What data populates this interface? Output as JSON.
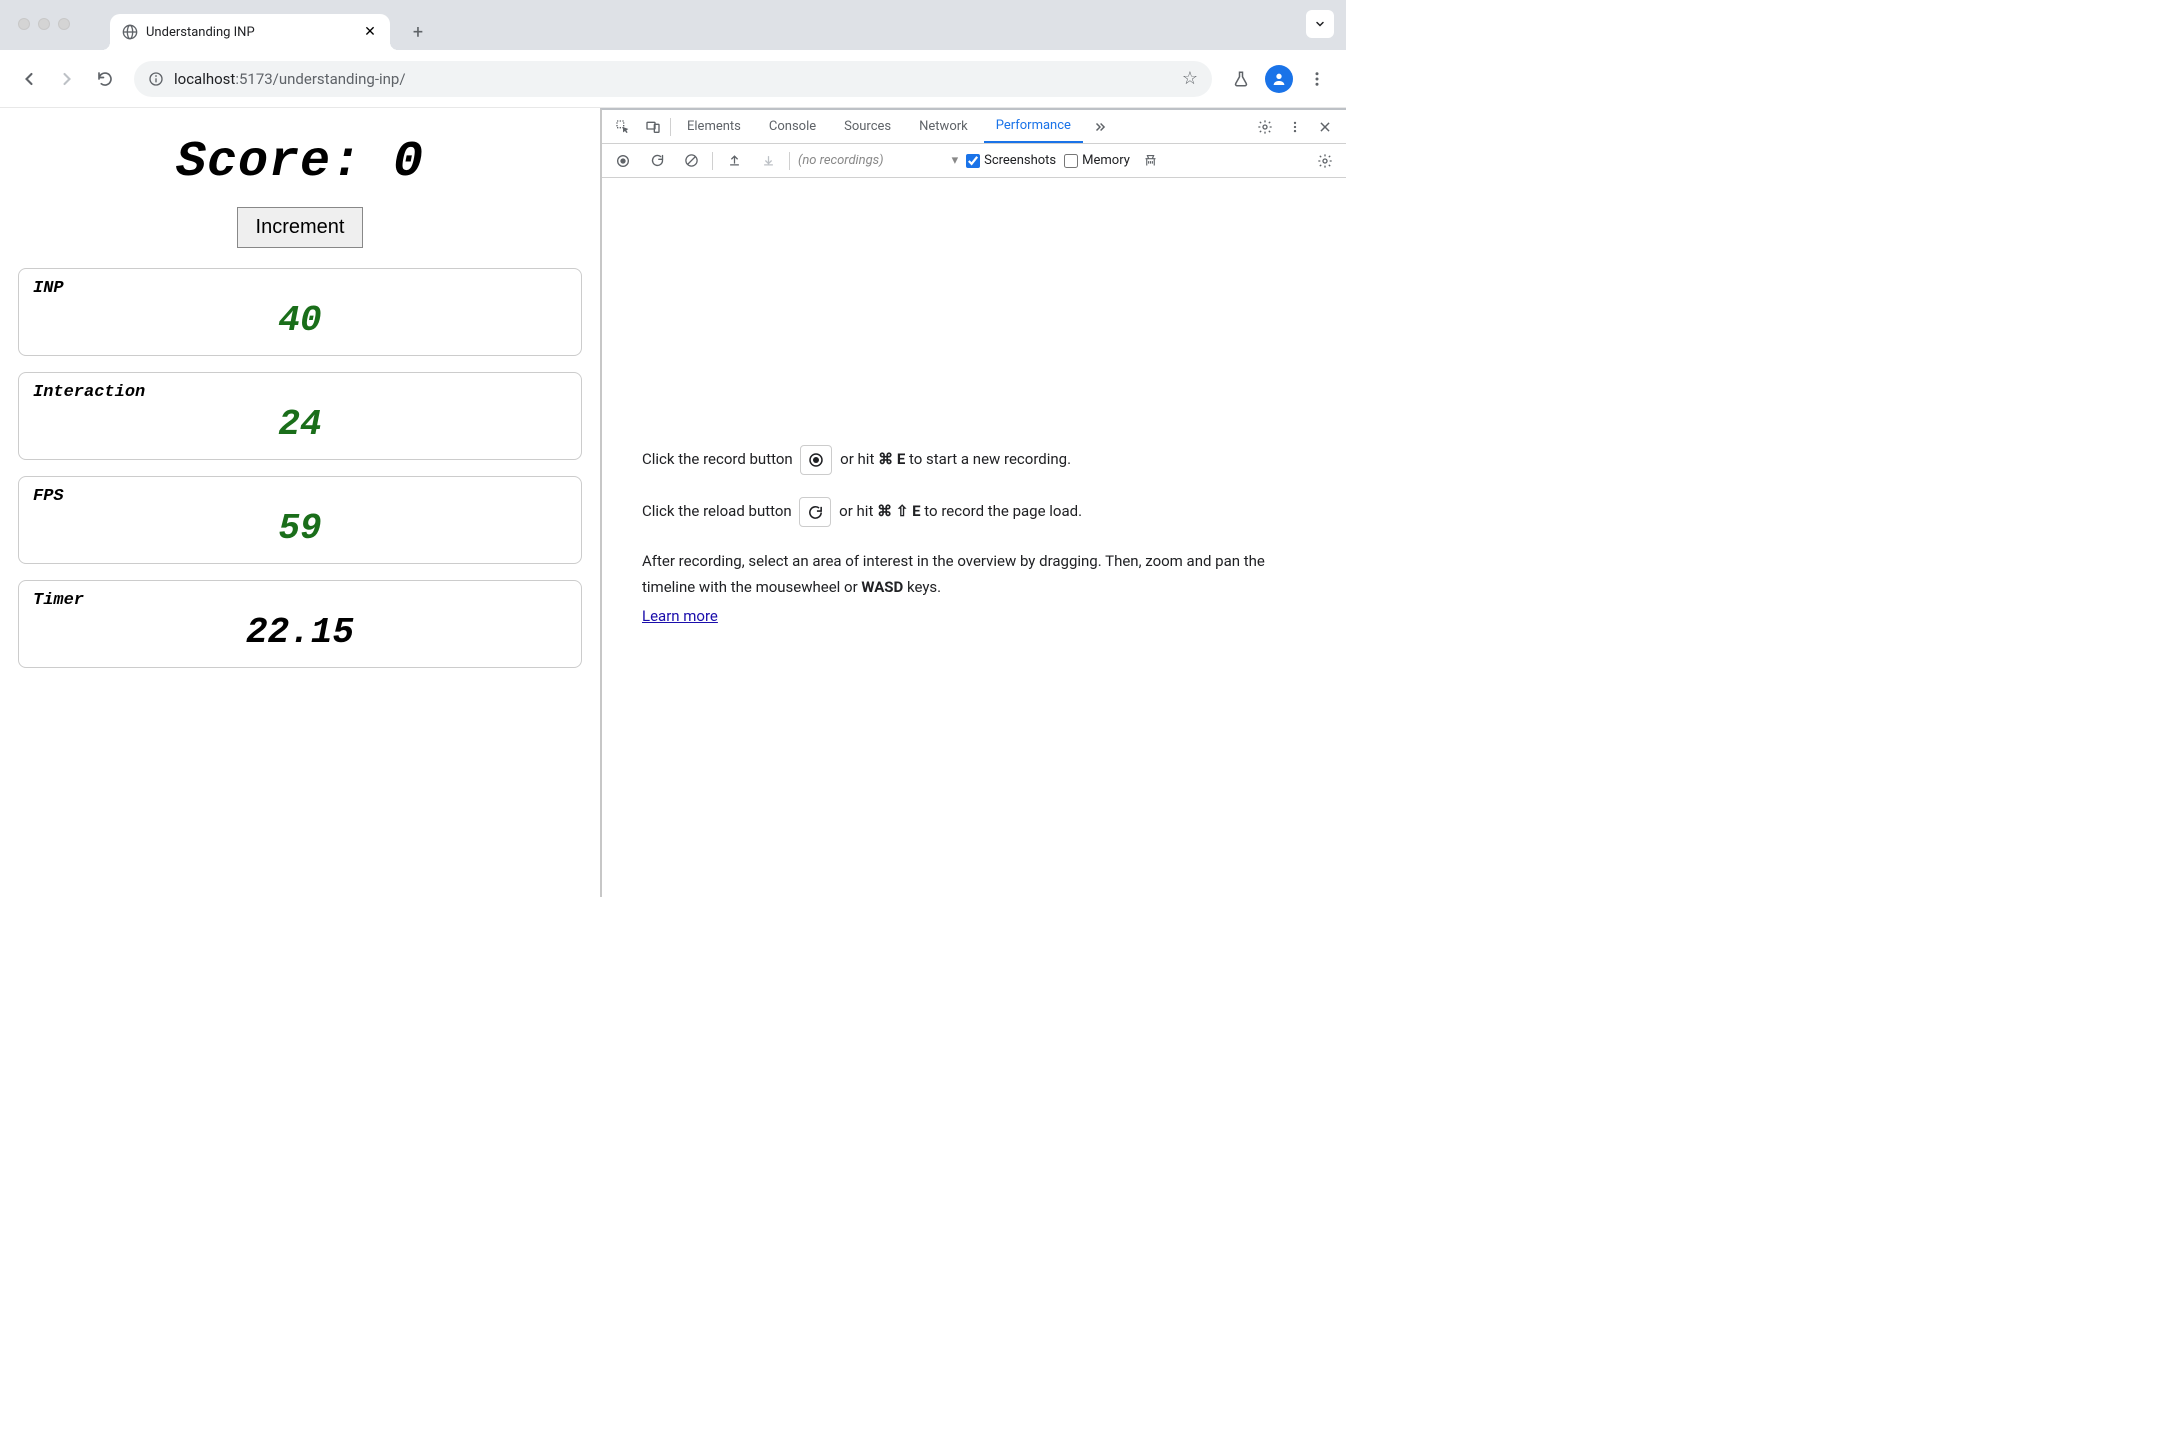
{
  "browser": {
    "tab_title": "Understanding INP",
    "url_host": "localhost",
    "url_port_path": ":5173/understanding-inp/"
  },
  "page": {
    "score_label": "Score:",
    "score_value": "0",
    "increment_label": "Increment",
    "metrics": [
      {
        "label": "INP",
        "value": "40",
        "color": "green"
      },
      {
        "label": "Interaction",
        "value": "24",
        "color": "green"
      },
      {
        "label": "FPS",
        "value": "59",
        "color": "green"
      },
      {
        "label": "Timer",
        "value": "22.15",
        "color": "black"
      }
    ]
  },
  "devtools": {
    "tabs": [
      "Elements",
      "Console",
      "Sources",
      "Network",
      "Performance"
    ],
    "active_tab": "Performance",
    "recordings_placeholder": "(no recordings)",
    "screenshots_label": "Screenshots",
    "screenshots_checked": true,
    "memory_label": "Memory",
    "memory_checked": false,
    "instr": {
      "line1_before": "Click the record button ",
      "line1_after": " or hit ",
      "line1_key1": "⌘",
      "line1_key2": "E",
      "line1_end": " to start a new recording.",
      "line2_before": "Click the reload button ",
      "line2_after": " or hit ",
      "line2_key1": "⌘",
      "line2_key2": "⇧",
      "line2_key3": "E",
      "line2_end": " to record the page load.",
      "line3_a": "After recording, select an area of interest in the overview by dragging. Then, zoom and pan the timeline with the mousewheel or ",
      "line3_wasd": "WASD",
      "line3_b": " keys.",
      "learn_more": "Learn more"
    }
  }
}
